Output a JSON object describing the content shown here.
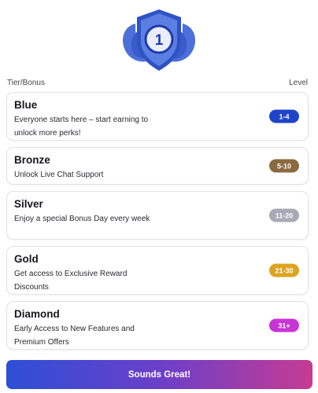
{
  "badge": {
    "number": "1",
    "icon": "shield-level-badge-icon",
    "color": "#3f68d8"
  },
  "header": {
    "left_label": "Tier/Bonus",
    "right_label": "Level"
  },
  "tiers": [
    {
      "name": "Blue",
      "description": "Everyone starts here – start earning to unlock more perks!",
      "level": "1-4",
      "color": "#1f44c9"
    },
    {
      "name": "Bronze",
      "description": "Unlock Live Chat Support",
      "level": "5-10",
      "color": "#8a6a3f"
    },
    {
      "name": "Silver",
      "description": "Enjoy a special Bonus Day every week",
      "level": "11-20",
      "color": "#a9a9b6"
    },
    {
      "name": "Gold",
      "description": "Get access to Exclusive Reward Discounts",
      "level": "21-30",
      "color": "#dca421"
    },
    {
      "name": "Diamond",
      "description": "Early Access to New Features and Premium Offers",
      "level": "31+",
      "color": "#c735d6"
    }
  ],
  "cta": {
    "label": "Sounds Great!"
  }
}
